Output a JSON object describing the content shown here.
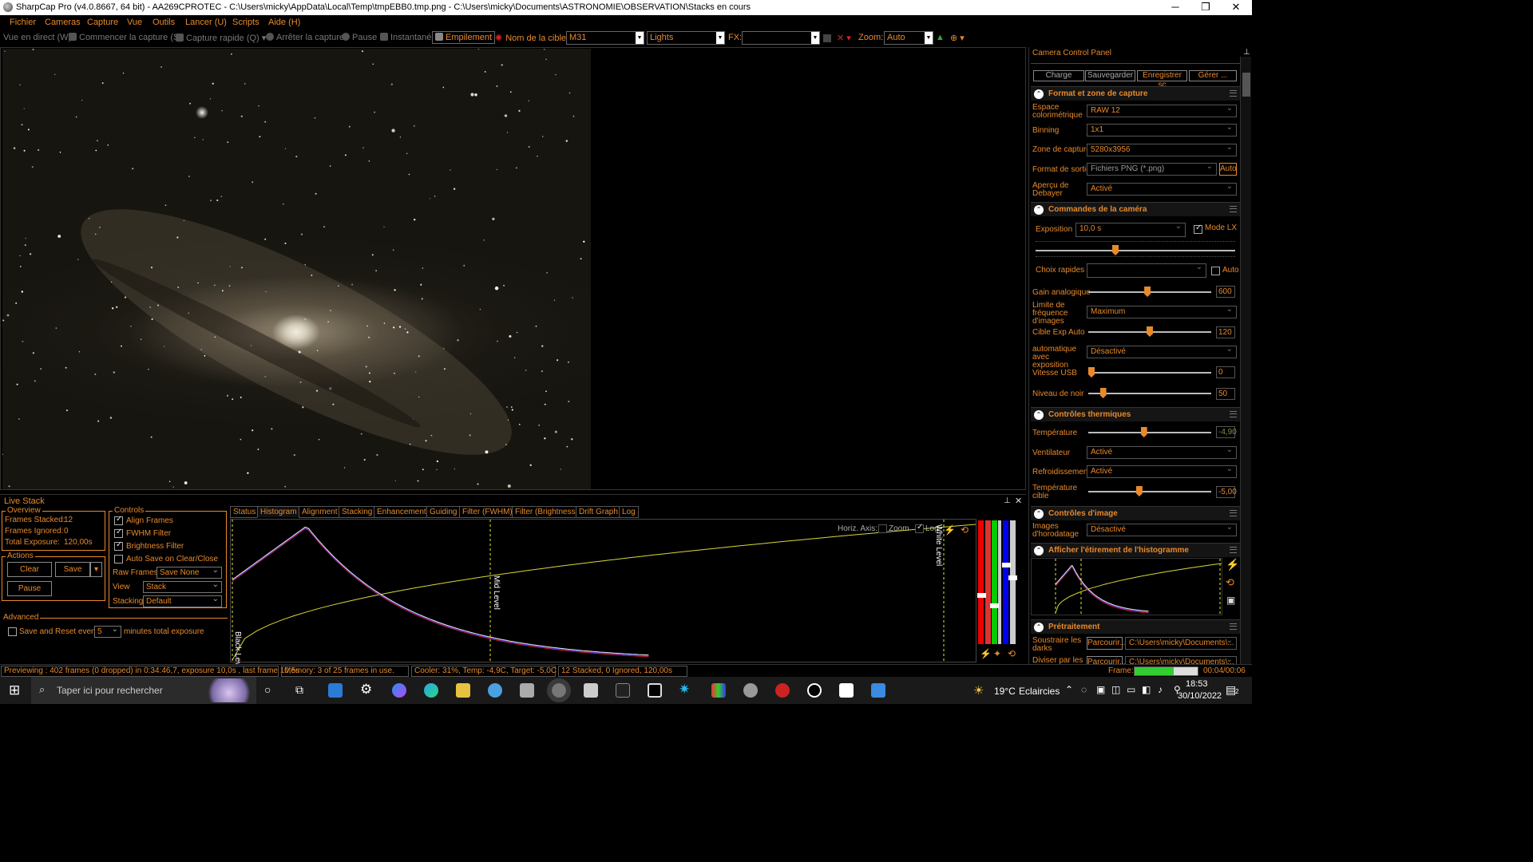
{
  "window": {
    "title": "SharpCap Pro (v4.0.8667, 64 bit) - AA269CPROTEC - C:\\Users\\micky\\AppData\\Local\\Temp\\tmpEBB0.tmp.png - C:\\Users\\micky\\Documents\\ASTRONOMIE\\OBSERVATION\\Stacks en cours",
    "minimize": "─",
    "maximize": "❐",
    "close": "✕"
  },
  "menu": [
    "Fichier",
    "Cameras",
    "Capture",
    "Vue",
    "Outils",
    "Lancer (U)",
    "Scripts",
    "Aide (H)"
  ],
  "toolbar": {
    "live_view": "Vue en direct (W)",
    "start_capture": "Commencer la capture (S)",
    "quick_capture": "Capture rapide (Q)",
    "stop_capture": "Arrêter la capture",
    "pause": "Pause",
    "snapshot": "Instantané",
    "stacking": "Empilement",
    "target_label": "Nom de la cible:",
    "target_value": "M31",
    "frame_type": "Lights",
    "fx_label": "FX:",
    "fx_value": "",
    "zoom_label": "Zoom:",
    "zoom_value": "Auto"
  },
  "live_stack": {
    "title": "Live Stack",
    "overview": {
      "label": "Overview",
      "frames_stacked": "Frames Stacked:",
      "frames_stacked_val": "12",
      "frames_ignored": "Frames Ignored:",
      "frames_ignored_val": "0",
      "total_exposure": "Total Exposure:",
      "total_exposure_val": "120,00s"
    },
    "actions": {
      "label": "Actions",
      "clear": "Clear",
      "save": "Save",
      "pause": "Pause"
    },
    "advanced": {
      "label": "Advanced",
      "save_reset": "Save and Reset every",
      "minutes": "5",
      "minutes_suffix": "minutes total exposure"
    },
    "controls": {
      "label": "Controls",
      "align": "Align Frames",
      "fwhm": "FWHM Filter",
      "brightness": "Brightness Filter",
      "autosave": "Auto Save on Clear/Close",
      "raw_frames": "Raw Frames",
      "raw_frames_val": "Save None",
      "view": "View",
      "view_val": "Stack",
      "stacking": "Stacking",
      "stacking_val": "Default"
    },
    "tabs": [
      "Status",
      "Histogram",
      "Alignment",
      "Stacking",
      "Enhancement",
      "Guiding",
      "Filter (FWHM)",
      "Filter (Brightness)",
      "Drift Graph",
      "Log"
    ],
    "histogram": {
      "horiz_axis": "Horiz. Axis:",
      "zoom": "Zoom",
      "log": "Log",
      "black_level": "Black Level",
      "mid_level": "Mid Level",
      "white_level": "White Level"
    }
  },
  "status": {
    "previewing": "Previewing : 402 frames (0 dropped) in 0:34:46,7, exposure 10,0s , last frame 10,5s",
    "memory": "Memory: 3 of 25 frames in use.",
    "cooler": "Cooler: 31%, Temp: -4,9C, Target: -5,0C",
    "stacked": "12 Stacked, 0 Ignored, 120,00s",
    "frame_label": "Frame:",
    "frame_time": "00:04/00:06",
    "frame_progress": 0.62
  },
  "right_panel": {
    "title": "Camera Control Panel",
    "buttons": [
      "Charge",
      "Sauvegarder",
      "Enregistrer sc",
      "Gérer ..."
    ],
    "format_section": "Format et zone de capture",
    "colorspace_label": "Espace colorimétrique",
    "colorspace": "RAW 12",
    "binning_label": "Binning",
    "binning": "1x1",
    "capture_area_label": "Zone de capture",
    "capture_area": "5280x3956",
    "output_label": "Format de sortie",
    "output": "Fichiers PNG (*.png)",
    "output_auto": "Auto",
    "debayer_label": "Aperçu de Debayer",
    "debayer": "Activé",
    "camera_section": "Commandes de la caméra",
    "exposure_label": "Exposition",
    "exposure": "10,0 s",
    "lx_mode": "Mode LX",
    "quick_choice": "Choix rapides",
    "auto": "Auto",
    "gain_label": "Gain analogique",
    "gain": "600",
    "gain_level": 0.48,
    "framerate_label": "Limite de fréquence d'images",
    "framerate": "Maximum",
    "autoexp_target_label": "Cible Exp Auto",
    "autoexp_target": "120",
    "autoexp_target_level": 0.5,
    "auto_exp_label": "automatique avec exposition",
    "auto_exp": "Désactivé",
    "usb_label": "Vitesse USB",
    "usb": "0",
    "usb_level": 0,
    "black_label": "Niveau de noir",
    "black": "50",
    "black_level": 0.1,
    "thermal_section": "Contrôles thermiques",
    "temp_label": "Température",
    "temp": "-4,90",
    "temp_level": 0.45,
    "fan_label": "Ventilateur",
    "fan": "Activé",
    "cooling_label": "Refroidissement",
    "cooling": "Activé",
    "target_temp_label": "Température cible",
    "target_temp": "-5,00",
    "target_temp_level": 0.41,
    "image_section": "Contrôles d'image",
    "timestamp_label": "Images d'horodatage",
    "timestamp": "Désactivé",
    "histo_section": "Afficher l'étirement de l'histogramme",
    "preprocess_section": "Prétraitement",
    "darks_label": "Soustraire les darks",
    "browse": "Parcourir...",
    "darks_path": "C:\\Users\\micky\\Documents\\...",
    "flats_label": "Diviser par les",
    "flats_browse": "Parcourir...",
    "flats_path": "C:\\Users\\micky\\Documents\\..."
  },
  "taskbar": {
    "search": "Taper ici pour rechercher",
    "weather_temp": "19°C",
    "weather_desc": "Eclaircies",
    "time": "18:53",
    "date": "30/10/2022",
    "notifications": "2"
  },
  "colors": {
    "accent": "#e8892b",
    "background": "#000000",
    "mid_level": "#e8e82b"
  }
}
